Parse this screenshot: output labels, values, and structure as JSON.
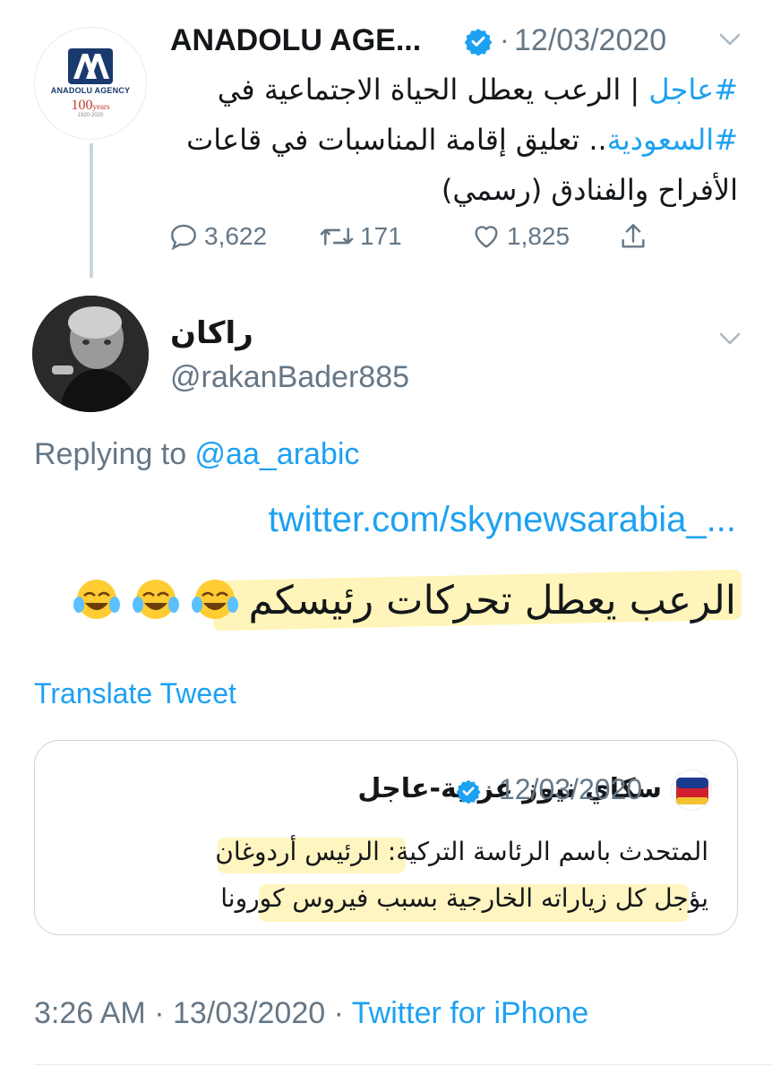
{
  "colors": {
    "accent": "#1da1f2",
    "muted": "#657786",
    "text": "#14171a",
    "highlight": "#ffec82"
  },
  "parent": {
    "avatar_icon": "anadolu-agency-logo",
    "logo_text": "ANADOLU AGENCY",
    "logo_years": "100",
    "logo_years_suffix": "years",
    "logo_range": "1920-2020",
    "name": "ANADOLU AGE...",
    "dot": "·",
    "date": "12/03/2020",
    "text_hashtag1": "#عاجل",
    "text_part1": " | الرعب يعطل الحياة الاجتماعية في ",
    "text_hashtag2": "#السعودية",
    "text_part2": ".. تعليق إقامة المناسبات في قاعات الأفراح والفنادق (رسمي)",
    "replies": "3,622",
    "retweets": "171",
    "likes": "1,825"
  },
  "reply": {
    "name": "راكان",
    "handle": "@rakanBader885",
    "replying_prefix": "Replying to ",
    "replying_mention": "@aa_arabic",
    "link": "twitter.com/skynewsarabia_...",
    "body": "الرعب يعطل تحركات رئيسكم",
    "emoji_icon": "face-with-tears-of-joy-icon",
    "translate": "Translate Tweet"
  },
  "quote": {
    "name": "سكاي نيوز عربية-عاجل",
    "dot": "·",
    "date": "12/03/2020",
    "text_line1": "المتحدث باسم الرئاسة التركية: الرئيس أردوغان",
    "text_line2": "يؤجل كل زياراته الخارجية بسبب فيروس كورونا"
  },
  "meta": {
    "time": "3:26 AM",
    "sep": " · ",
    "date": "13/03/2020",
    "source": "Twitter for iPhone"
  }
}
